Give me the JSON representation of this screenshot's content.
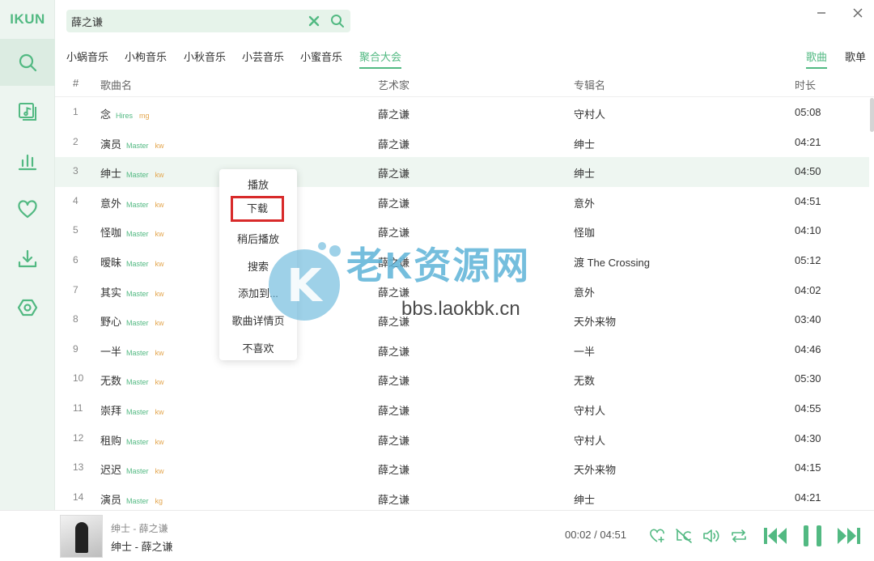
{
  "app": {
    "logo": "IKUN"
  },
  "sidebar": {
    "items": [
      {
        "name": "search",
        "icon": "search-icon",
        "active": true
      },
      {
        "name": "songlist",
        "icon": "music-library-icon",
        "active": false
      },
      {
        "name": "charts",
        "icon": "chart-icon",
        "active": false
      },
      {
        "name": "favorites",
        "icon": "heart-icon",
        "active": false
      },
      {
        "name": "downloads",
        "icon": "download-icon",
        "active": false
      },
      {
        "name": "settings",
        "icon": "settings-hexagon-icon",
        "active": false
      }
    ]
  },
  "search": {
    "value": "薛之谦",
    "placeholder": ""
  },
  "sources": [
    {
      "label": "小蜗音乐",
      "active": false
    },
    {
      "label": "小枸音乐",
      "active": false
    },
    {
      "label": "小秋音乐",
      "active": false
    },
    {
      "label": "小芸音乐",
      "active": false
    },
    {
      "label": "小蜜音乐",
      "active": false
    },
    {
      "label": "聚合大会",
      "active": true
    }
  ],
  "result_types": [
    {
      "label": "歌曲",
      "active": true
    },
    {
      "label": "歌单",
      "active": false
    }
  ],
  "table": {
    "headers": {
      "num": "#",
      "name": "歌曲名",
      "artist": "艺术家",
      "album": "专辑名",
      "duration": "时长"
    },
    "rows": [
      {
        "num": "1",
        "name": "念",
        "quality": "Hires",
        "source": "mg",
        "artist": "薛之谦",
        "album": "守村人",
        "duration": "05:08"
      },
      {
        "num": "2",
        "name": "演员",
        "quality": "Master",
        "source": "kw",
        "artist": "薛之谦",
        "album": "绅士",
        "duration": "04:21"
      },
      {
        "num": "3",
        "name": "绅士",
        "quality": "Master",
        "source": "kw",
        "artist": "薛之谦",
        "album": "绅士",
        "duration": "04:50"
      },
      {
        "num": "4",
        "name": "意外",
        "quality": "Master",
        "source": "kw",
        "artist": "薛之谦",
        "album": "意外",
        "duration": "04:51"
      },
      {
        "num": "5",
        "name": "怪咖",
        "quality": "Master",
        "source": "kw",
        "artist": "薛之谦",
        "album": "怪咖",
        "duration": "04:10"
      },
      {
        "num": "6",
        "name": "暧昧",
        "quality": "Master",
        "source": "kw",
        "artist": "薛之谦",
        "album": "渡 The Crossing",
        "duration": "05:12"
      },
      {
        "num": "7",
        "name": "其实",
        "quality": "Master",
        "source": "kw",
        "artist": "薛之谦",
        "album": "意外",
        "duration": "04:02"
      },
      {
        "num": "8",
        "name": "野心",
        "quality": "Master",
        "source": "kw",
        "artist": "薛之谦",
        "album": "天外来物",
        "duration": "03:40"
      },
      {
        "num": "9",
        "name": "一半",
        "quality": "Master",
        "source": "kw",
        "artist": "薛之谦",
        "album": "一半",
        "duration": "04:46"
      },
      {
        "num": "10",
        "name": "无数",
        "quality": "Master",
        "source": "kw",
        "artist": "薛之谦",
        "album": "无数",
        "duration": "05:30"
      },
      {
        "num": "11",
        "name": "崇拜",
        "quality": "Master",
        "source": "kw",
        "artist": "薛之谦",
        "album": "守村人",
        "duration": "04:55"
      },
      {
        "num": "12",
        "name": "租购",
        "quality": "Master",
        "source": "kw",
        "artist": "薛之谦",
        "album": "守村人",
        "duration": "04:30"
      },
      {
        "num": "13",
        "name": "迟迟",
        "quality": "Master",
        "source": "kw",
        "artist": "薛之谦",
        "album": "天外来物",
        "duration": "04:15"
      },
      {
        "num": "14",
        "name": "演员",
        "quality": "Master",
        "source": "kg",
        "artist": "薛之谦",
        "album": "绅士",
        "duration": "04:21"
      }
    ]
  },
  "context_menu": {
    "items": [
      "播放",
      "下载",
      "稍后播放",
      "搜索",
      "添加到...",
      "歌曲详情页",
      "不喜欢"
    ],
    "highlighted_index": 1
  },
  "watermark": {
    "title": "老K资源网",
    "url": "bbs.laokbk.cn",
    "badge": "K"
  },
  "player": {
    "subtitle": "绅士 - 薛之谦",
    "title": "绅士 - 薛之谦",
    "current_time": "00:02",
    "separator": "/",
    "total_time": "04:51",
    "playing": true
  },
  "colors": {
    "accent": "#52b982",
    "sidebar_bg": "#edf5f0",
    "source_tag": "#e3a54c",
    "highlight_box": "#d82a2a",
    "watermark": "#5eb3d8"
  }
}
